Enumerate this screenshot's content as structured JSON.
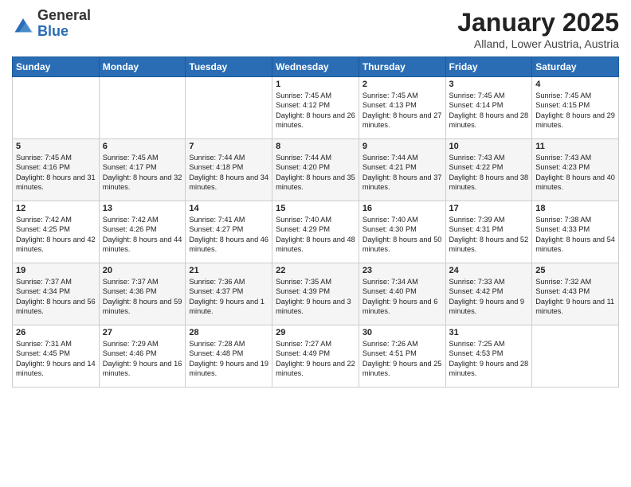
{
  "logo": {
    "general": "General",
    "blue": "Blue"
  },
  "title": "January 2025",
  "subtitle": "Alland, Lower Austria, Austria",
  "days_header": [
    "Sunday",
    "Monday",
    "Tuesday",
    "Wednesday",
    "Thursday",
    "Friday",
    "Saturday"
  ],
  "weeks": [
    [
      {
        "day": "",
        "content": ""
      },
      {
        "day": "",
        "content": ""
      },
      {
        "day": "",
        "content": ""
      },
      {
        "day": "1",
        "content": "Sunrise: 7:45 AM\nSunset: 4:12 PM\nDaylight: 8 hours and 26 minutes."
      },
      {
        "day": "2",
        "content": "Sunrise: 7:45 AM\nSunset: 4:13 PM\nDaylight: 8 hours and 27 minutes."
      },
      {
        "day": "3",
        "content": "Sunrise: 7:45 AM\nSunset: 4:14 PM\nDaylight: 8 hours and 28 minutes."
      },
      {
        "day": "4",
        "content": "Sunrise: 7:45 AM\nSunset: 4:15 PM\nDaylight: 8 hours and 29 minutes."
      }
    ],
    [
      {
        "day": "5",
        "content": "Sunrise: 7:45 AM\nSunset: 4:16 PM\nDaylight: 8 hours and 31 minutes."
      },
      {
        "day": "6",
        "content": "Sunrise: 7:45 AM\nSunset: 4:17 PM\nDaylight: 8 hours and 32 minutes."
      },
      {
        "day": "7",
        "content": "Sunrise: 7:44 AM\nSunset: 4:18 PM\nDaylight: 8 hours and 34 minutes."
      },
      {
        "day": "8",
        "content": "Sunrise: 7:44 AM\nSunset: 4:20 PM\nDaylight: 8 hours and 35 minutes."
      },
      {
        "day": "9",
        "content": "Sunrise: 7:44 AM\nSunset: 4:21 PM\nDaylight: 8 hours and 37 minutes."
      },
      {
        "day": "10",
        "content": "Sunrise: 7:43 AM\nSunset: 4:22 PM\nDaylight: 8 hours and 38 minutes."
      },
      {
        "day": "11",
        "content": "Sunrise: 7:43 AM\nSunset: 4:23 PM\nDaylight: 8 hours and 40 minutes."
      }
    ],
    [
      {
        "day": "12",
        "content": "Sunrise: 7:42 AM\nSunset: 4:25 PM\nDaylight: 8 hours and 42 minutes."
      },
      {
        "day": "13",
        "content": "Sunrise: 7:42 AM\nSunset: 4:26 PM\nDaylight: 8 hours and 44 minutes."
      },
      {
        "day": "14",
        "content": "Sunrise: 7:41 AM\nSunset: 4:27 PM\nDaylight: 8 hours and 46 minutes."
      },
      {
        "day": "15",
        "content": "Sunrise: 7:40 AM\nSunset: 4:29 PM\nDaylight: 8 hours and 48 minutes."
      },
      {
        "day": "16",
        "content": "Sunrise: 7:40 AM\nSunset: 4:30 PM\nDaylight: 8 hours and 50 minutes."
      },
      {
        "day": "17",
        "content": "Sunrise: 7:39 AM\nSunset: 4:31 PM\nDaylight: 8 hours and 52 minutes."
      },
      {
        "day": "18",
        "content": "Sunrise: 7:38 AM\nSunset: 4:33 PM\nDaylight: 8 hours and 54 minutes."
      }
    ],
    [
      {
        "day": "19",
        "content": "Sunrise: 7:37 AM\nSunset: 4:34 PM\nDaylight: 8 hours and 56 minutes."
      },
      {
        "day": "20",
        "content": "Sunrise: 7:37 AM\nSunset: 4:36 PM\nDaylight: 8 hours and 59 minutes."
      },
      {
        "day": "21",
        "content": "Sunrise: 7:36 AM\nSunset: 4:37 PM\nDaylight: 9 hours and 1 minute."
      },
      {
        "day": "22",
        "content": "Sunrise: 7:35 AM\nSunset: 4:39 PM\nDaylight: 9 hours and 3 minutes."
      },
      {
        "day": "23",
        "content": "Sunrise: 7:34 AM\nSunset: 4:40 PM\nDaylight: 9 hours and 6 minutes."
      },
      {
        "day": "24",
        "content": "Sunrise: 7:33 AM\nSunset: 4:42 PM\nDaylight: 9 hours and 9 minutes."
      },
      {
        "day": "25",
        "content": "Sunrise: 7:32 AM\nSunset: 4:43 PM\nDaylight: 9 hours and 11 minutes."
      }
    ],
    [
      {
        "day": "26",
        "content": "Sunrise: 7:31 AM\nSunset: 4:45 PM\nDaylight: 9 hours and 14 minutes."
      },
      {
        "day": "27",
        "content": "Sunrise: 7:29 AM\nSunset: 4:46 PM\nDaylight: 9 hours and 16 minutes."
      },
      {
        "day": "28",
        "content": "Sunrise: 7:28 AM\nSunset: 4:48 PM\nDaylight: 9 hours and 19 minutes."
      },
      {
        "day": "29",
        "content": "Sunrise: 7:27 AM\nSunset: 4:49 PM\nDaylight: 9 hours and 22 minutes."
      },
      {
        "day": "30",
        "content": "Sunrise: 7:26 AM\nSunset: 4:51 PM\nDaylight: 9 hours and 25 minutes."
      },
      {
        "day": "31",
        "content": "Sunrise: 7:25 AM\nSunset: 4:53 PM\nDaylight: 9 hours and 28 minutes."
      },
      {
        "day": "",
        "content": ""
      }
    ]
  ]
}
